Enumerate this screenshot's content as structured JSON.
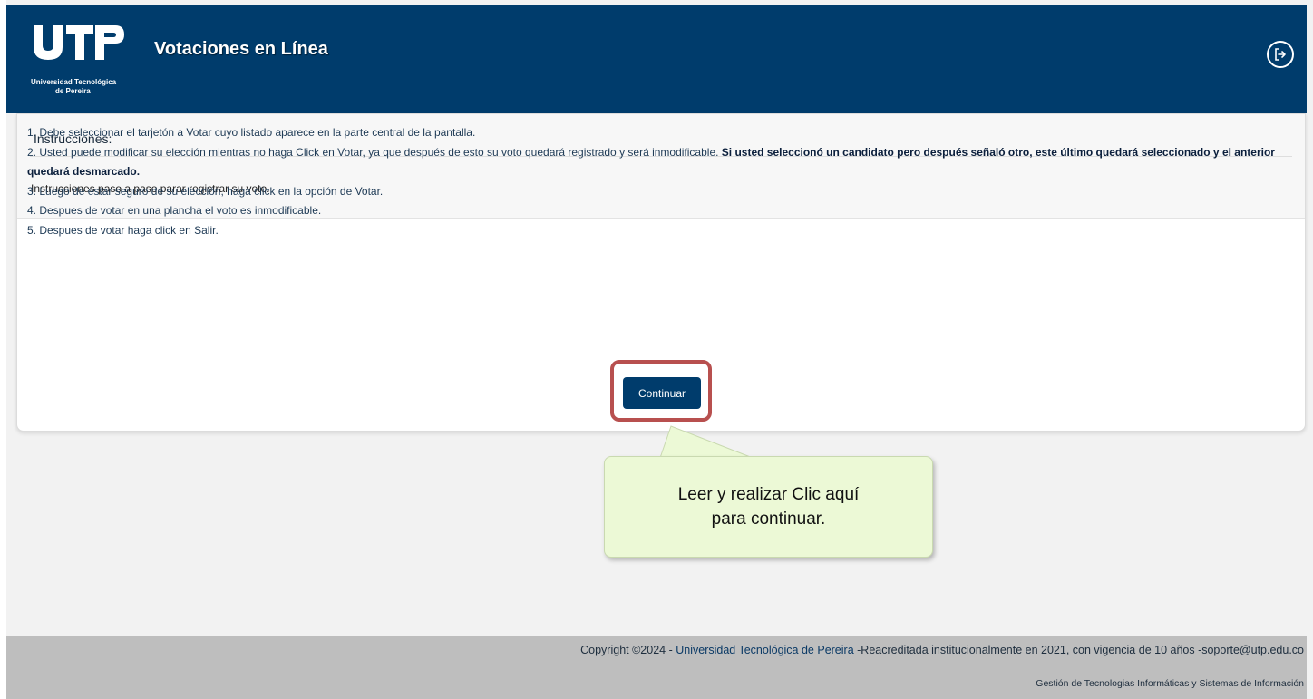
{
  "header": {
    "logo_letters": "UTP",
    "logo_line1": "Universidad Tecnológica",
    "logo_line2": "de Pereira",
    "title": "Votaciones en Línea",
    "logout_icon": "logout-icon"
  },
  "panel": {
    "title": "Instrucciones:",
    "subtitle": "Instrucciones paso a paso parar registrar su voto.",
    "steps": {
      "s1": "1. Debe seleccionar el tarjetón a Votar cuyo listado aparece en la parte central de la pantalla.",
      "s2": "2. Usted puede modificar su elección mientras no haga Click en Votar, ya que después de esto su voto quedará registrado y será inmodificable.",
      "s2_bold": "Si usted seleccionó un candidato pero después señaló otro, este último quedará seleccionado y el anterior quedará desmarcado.",
      "s3": "3. Luego de estar seguro de su elección, haga click en la opción de Votar.",
      "s4": "4. Despues de votar en una plancha el voto es inmodificable.",
      "s5": "5. Despues de votar haga click en Salir."
    },
    "continue_label": "Continuar"
  },
  "callout": {
    "line1": "Leer y realizar Clic aquí",
    "line2": "para continuar."
  },
  "footer": {
    "copyright_prefix": "Copyright ©2024 - ",
    "copyright_link": "Universidad Tecnológica de Pereira",
    "copyright_suffix": " -Reacreditada institucionalmente en 2021, con vigencia de 10 años -soporte@utp.edu.co",
    "department": "Gestión de Tecnologias Informáticas y Sistemas de Información"
  },
  "colors": {
    "brand_navy": "#003c6c",
    "highlight_red": "#b8504f",
    "callout_green": "#ecf9d6"
  }
}
